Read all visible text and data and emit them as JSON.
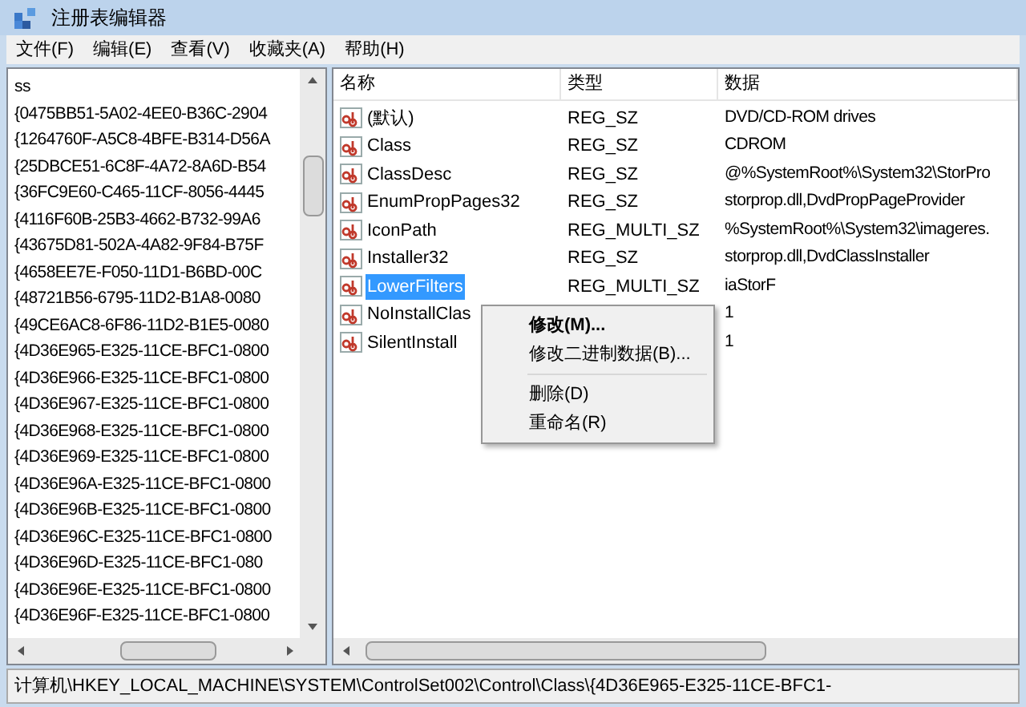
{
  "window": {
    "title": "注册表编辑器"
  },
  "menu": [
    "文件(F)",
    "编辑(E)",
    "查看(V)",
    "收藏夹(A)",
    "帮助(H)"
  ],
  "tree": {
    "items": [
      {
        "label": "ss",
        "selected": false
      },
      {
        "label": "{0475BB51-5A02-4EE0-B36C-2904",
        "selected": false
      },
      {
        "label": "{1264760F-A5C8-4BFE-B314-D56A",
        "selected": false
      },
      {
        "label": "{25DBCE51-6C8F-4A72-8A6D-B54",
        "selected": false
      },
      {
        "label": "{36FC9E60-C465-11CF-8056-4445",
        "selected": false
      },
      {
        "label": "{4116F60B-25B3-4662-B732-99A6",
        "selected": false
      },
      {
        "label": "{43675D81-502A-4A82-9F84-B75F",
        "selected": false
      },
      {
        "label": "{4658EE7E-F050-11D1-B6BD-00C",
        "selected": false
      },
      {
        "label": "{48721B56-6795-11D2-B1A8-0080",
        "selected": false
      },
      {
        "label": "{49CE6AC8-6F86-11D2-B1E5-0080",
        "selected": false
      },
      {
        "label": "{4D36E965-E325-11CE-BFC1-0800",
        "selected": false
      },
      {
        "label": "{4D36E966-E325-11CE-BFC1-0800",
        "selected": false
      },
      {
        "label": "{4D36E967-E325-11CE-BFC1-0800",
        "selected": false
      },
      {
        "label": "{4D36E968-E325-11CE-BFC1-0800",
        "selected": false
      },
      {
        "label": "{4D36E969-E325-11CE-BFC1-0800",
        "selected": false
      },
      {
        "label": "{4D36E96A-E325-11CE-BFC1-0800",
        "selected": false
      },
      {
        "label": "{4D36E96B-E325-11CE-BFC1-0800",
        "selected": false
      },
      {
        "label": "{4D36E96C-E325-11CE-BFC1-0800",
        "selected": false
      },
      {
        "label": "{4D36E96D-E325-11CE-BFC1-080",
        "selected": false
      },
      {
        "label": "{4D36E96E-E325-11CE-BFC1-0800",
        "selected": false
      },
      {
        "label": "{4D36E96F-E325-11CE-BFC1-0800",
        "selected": false
      }
    ]
  },
  "values": {
    "columns": [
      "名称",
      "类型",
      "数据"
    ],
    "rows": [
      {
        "name": "(默认)",
        "type": "REG_SZ",
        "data": "DVD/CD-ROM drives",
        "selected": false
      },
      {
        "name": "Class",
        "type": "REG_SZ",
        "data": "CDROM",
        "selected": false
      },
      {
        "name": "ClassDesc",
        "type": "REG_SZ",
        "data": "@%SystemRoot%\\System32\\StorPro",
        "selected": false
      },
      {
        "name": "EnumPropPages32",
        "type": "REG_SZ",
        "data": "storprop.dll,DvdPropPageProvider",
        "selected": false
      },
      {
        "name": "IconPath",
        "type": "REG_MULTI_SZ",
        "data": "%SystemRoot%\\System32\\imageres.",
        "selected": false
      },
      {
        "name": "Installer32",
        "type": "REG_SZ",
        "data": "storprop.dll,DvdClassInstaller",
        "selected": false
      },
      {
        "name": "LowerFilters",
        "type": "REG_MULTI_SZ",
        "data": "iaStorF",
        "selected": true
      },
      {
        "name": "NoInstallClas",
        "data": "1",
        "selected": false
      },
      {
        "name": "SilentInstall",
        "data": "1",
        "selected": false
      }
    ]
  },
  "context_menu": [
    {
      "kind": "item",
      "label": "修改(M)...",
      "default": true
    },
    {
      "kind": "item",
      "label": "修改二进制数据(B)...",
      "default": false
    },
    {
      "kind": "separator"
    },
    {
      "kind": "item",
      "label": "删除(D)",
      "default": false
    },
    {
      "kind": "item",
      "label": "重命名(R)",
      "default": false
    }
  ],
  "status_bar": "计算机\\HKEY_LOCAL_MACHINE\\SYSTEM\\ControlSet002\\Control\\Class\\{4D36E965-E325-11CE-BFC1-"
}
